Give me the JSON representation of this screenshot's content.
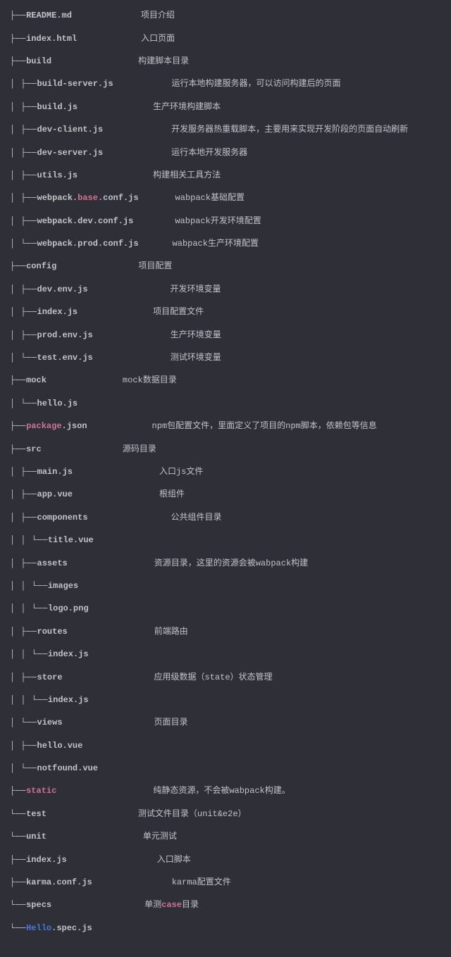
{
  "lines": [
    {
      "tree": "├── ",
      "parts": [
        {
          "t": "README.md",
          "c": "name"
        }
      ],
      "gap": 98,
      "desc": "项目介绍"
    },
    {
      "tree": "├── ",
      "parts": [
        {
          "t": "index.html",
          "c": "name"
        }
      ],
      "gap": 91,
      "desc": "入口页面"
    },
    {
      "tree": "├── ",
      "parts": [
        {
          "t": "build",
          "c": "name"
        }
      ],
      "gap": 123,
      "desc": "构建脚本目录"
    },
    {
      "tree": "│   ├── ",
      "parts": [
        {
          "t": "build-server.js",
          "c": "name"
        }
      ],
      "gap": 83,
      "desc": "运行本地构建服务器，可以访问构建后的页面"
    },
    {
      "tree": "│   ├── ",
      "parts": [
        {
          "t": "build.js",
          "c": "name"
        }
      ],
      "gap": 107,
      "desc": "生产环境构建脚本"
    },
    {
      "tree": "│   ├── ",
      "parts": [
        {
          "t": "dev-client.js",
          "c": "name"
        }
      ],
      "gap": 97,
      "desc": "开发服务器热重载脚本，主要用来实现开发阶段的页面自动刷新"
    },
    {
      "tree": "│   ├── ",
      "parts": [
        {
          "t": "dev-server.js",
          "c": "name"
        }
      ],
      "gap": 97,
      "desc": "运行本地开发服务器"
    },
    {
      "tree": "│   ├── ",
      "parts": [
        {
          "t": "utils.js",
          "c": "name"
        }
      ],
      "gap": 107,
      "desc": "构建相关工具方法"
    },
    {
      "tree": "│   ├── ",
      "parts": [
        {
          "t": "webpack.",
          "c": "name"
        },
        {
          "t": "base",
          "c": "hl"
        },
        {
          "t": ".conf.js",
          "c": "name"
        }
      ],
      "gap": 52,
      "desc": "wabpack基础配置"
    },
    {
      "tree": "│   ├── ",
      "parts": [
        {
          "t": "webpack.dev.conf.js",
          "c": "name"
        }
      ],
      "gap": 59,
      "desc": "wabpack开发环境配置"
    },
    {
      "tree": "│   └── ",
      "parts": [
        {
          "t": "webpack.prod.conf.js",
          "c": "name"
        }
      ],
      "gap": 48,
      "desc": "wabpack生产环境配置"
    },
    {
      "tree": "├── ",
      "parts": [
        {
          "t": "config",
          "c": "name"
        }
      ],
      "gap": 116,
      "desc": "项目配置"
    },
    {
      "tree": "│   ├── ",
      "parts": [
        {
          "t": "dev.env.js",
          "c": "name"
        }
      ],
      "gap": 117,
      "desc": "开发环境变量"
    },
    {
      "tree": "│   ├── ",
      "parts": [
        {
          "t": "index.js",
          "c": "name"
        }
      ],
      "gap": 107,
      "desc": "项目配置文件"
    },
    {
      "tree": "│   ├── ",
      "parts": [
        {
          "t": "prod.env.js",
          "c": "name"
        }
      ],
      "gap": 110,
      "desc": "生产环境变量"
    },
    {
      "tree": "│   └── ",
      "parts": [
        {
          "t": "test.env.js",
          "c": "name"
        }
      ],
      "gap": 110,
      "desc": "测试环境变量"
    },
    {
      "tree": "├── ",
      "parts": [
        {
          "t": "mock",
          "c": "name"
        }
      ],
      "gap": 108,
      "desc": "mock数据目录"
    },
    {
      "tree": "│   └── ",
      "parts": [
        {
          "t": "hello.js",
          "c": "name"
        }
      ],
      "gap": 0,
      "desc": ""
    },
    {
      "tree": "├── ",
      "parts": [
        {
          "t": "package",
          "c": "hl"
        },
        {
          "t": ".json",
          "c": "name"
        }
      ],
      "gap": 92,
      "desc": "npm包配置文件，里面定义了项目的npm脚本，依赖包等信息"
    },
    {
      "tree": "├── ",
      "parts": [
        {
          "t": "src",
          "c": "name"
        }
      ],
      "gap": 115,
      "desc": "源码目录"
    },
    {
      "tree": "│   ├── ",
      "parts": [
        {
          "t": "main.js",
          "c": "name"
        }
      ],
      "gap": 123,
      "desc": "入口js文件"
    },
    {
      "tree": "│   ├── ",
      "parts": [
        {
          "t": "app.vue",
          "c": "name"
        }
      ],
      "gap": 123,
      "desc": "根组件"
    },
    {
      "tree": "│   ├── ",
      "parts": [
        {
          "t": "components",
          "c": "name"
        }
      ],
      "gap": 118,
      "desc": "公共组件目录"
    },
    {
      "tree": "│   │   └── ",
      "parts": [
        {
          "t": "title.vue",
          "c": "name"
        }
      ],
      "gap": 0,
      "desc": ""
    },
    {
      "tree": "│   ├── ",
      "parts": [
        {
          "t": "assets",
          "c": "name"
        }
      ],
      "gap": 123,
      "desc": "资源目录，这里的资源会被wabpack构建"
    },
    {
      "tree": "│   │   └── ",
      "parts": [
        {
          "t": "images",
          "c": "name"
        }
      ],
      "gap": 0,
      "desc": ""
    },
    {
      "tree": "│   │       └── ",
      "parts": [
        {
          "t": "logo.png",
          "c": "name"
        }
      ],
      "gap": 0,
      "desc": ""
    },
    {
      "tree": "│   ├── ",
      "parts": [
        {
          "t": "routes",
          "c": "name"
        }
      ],
      "gap": 123,
      "desc": "前端路由"
    },
    {
      "tree": "│   │   └── ",
      "parts": [
        {
          "t": "index.js",
          "c": "name"
        }
      ],
      "gap": 0,
      "desc": ""
    },
    {
      "tree": "│   ├── ",
      "parts": [
        {
          "t": "store",
          "c": "name"
        }
      ],
      "gap": 130,
      "desc": "应用级数据（state）状态管理"
    },
    {
      "tree": "│   │   └── ",
      "parts": [
        {
          "t": "index.js",
          "c": "name"
        }
      ],
      "gap": 0,
      "desc": ""
    },
    {
      "tree": "│   └── ",
      "parts": [
        {
          "t": "views",
          "c": "name"
        }
      ],
      "gap": 130,
      "desc": "页面目录"
    },
    {
      "tree": "│       ├── ",
      "parts": [
        {
          "t": "hello.vue",
          "c": "name"
        }
      ],
      "gap": 0,
      "desc": ""
    },
    {
      "tree": "│       └── ",
      "parts": [
        {
          "t": "notfound.vue",
          "c": "name"
        }
      ],
      "gap": 0,
      "desc": ""
    },
    {
      "tree": "├── ",
      "parts": [
        {
          "t": "static",
          "c": "hl"
        }
      ],
      "gap": 137,
      "desc": "纯静态资源，不会被wabpack构建。"
    },
    {
      "tree": "└── ",
      "parts": [
        {
          "t": "test",
          "c": "name"
        }
      ],
      "gap": 130,
      "desc": "测试文件目录（unit&e2e）"
    },
    {
      "tree": "    └── ",
      "parts": [
        {
          "t": "unit",
          "c": "name"
        }
      ],
      "gap": 137,
      "desc": "单元测试"
    },
    {
      "tree": "        ├── ",
      "parts": [
        {
          "t": "index.js",
          "c": "name"
        }
      ],
      "gap": 128,
      "desc": "入口脚本"
    },
    {
      "tree": "        ├── ",
      "parts": [
        {
          "t": "karma.conf.js",
          "c": "name"
        }
      ],
      "gap": 113,
      "desc": "karma配置文件"
    },
    {
      "tree": "        └── ",
      "parts": [
        {
          "t": "specs",
          "c": "name"
        }
      ],
      "gap": 132,
      "descParts": [
        {
          "t": "单测",
          "c": "desc"
        },
        {
          "t": "case",
          "c": "hl"
        },
        {
          "t": "目录",
          "c": "desc"
        }
      ]
    },
    {
      "tree": "            └── ",
      "parts": [
        {
          "t": "Hello",
          "c": "link"
        },
        {
          "t": ".spec.js",
          "c": "name"
        }
      ],
      "gap": 0,
      "desc": ""
    }
  ]
}
